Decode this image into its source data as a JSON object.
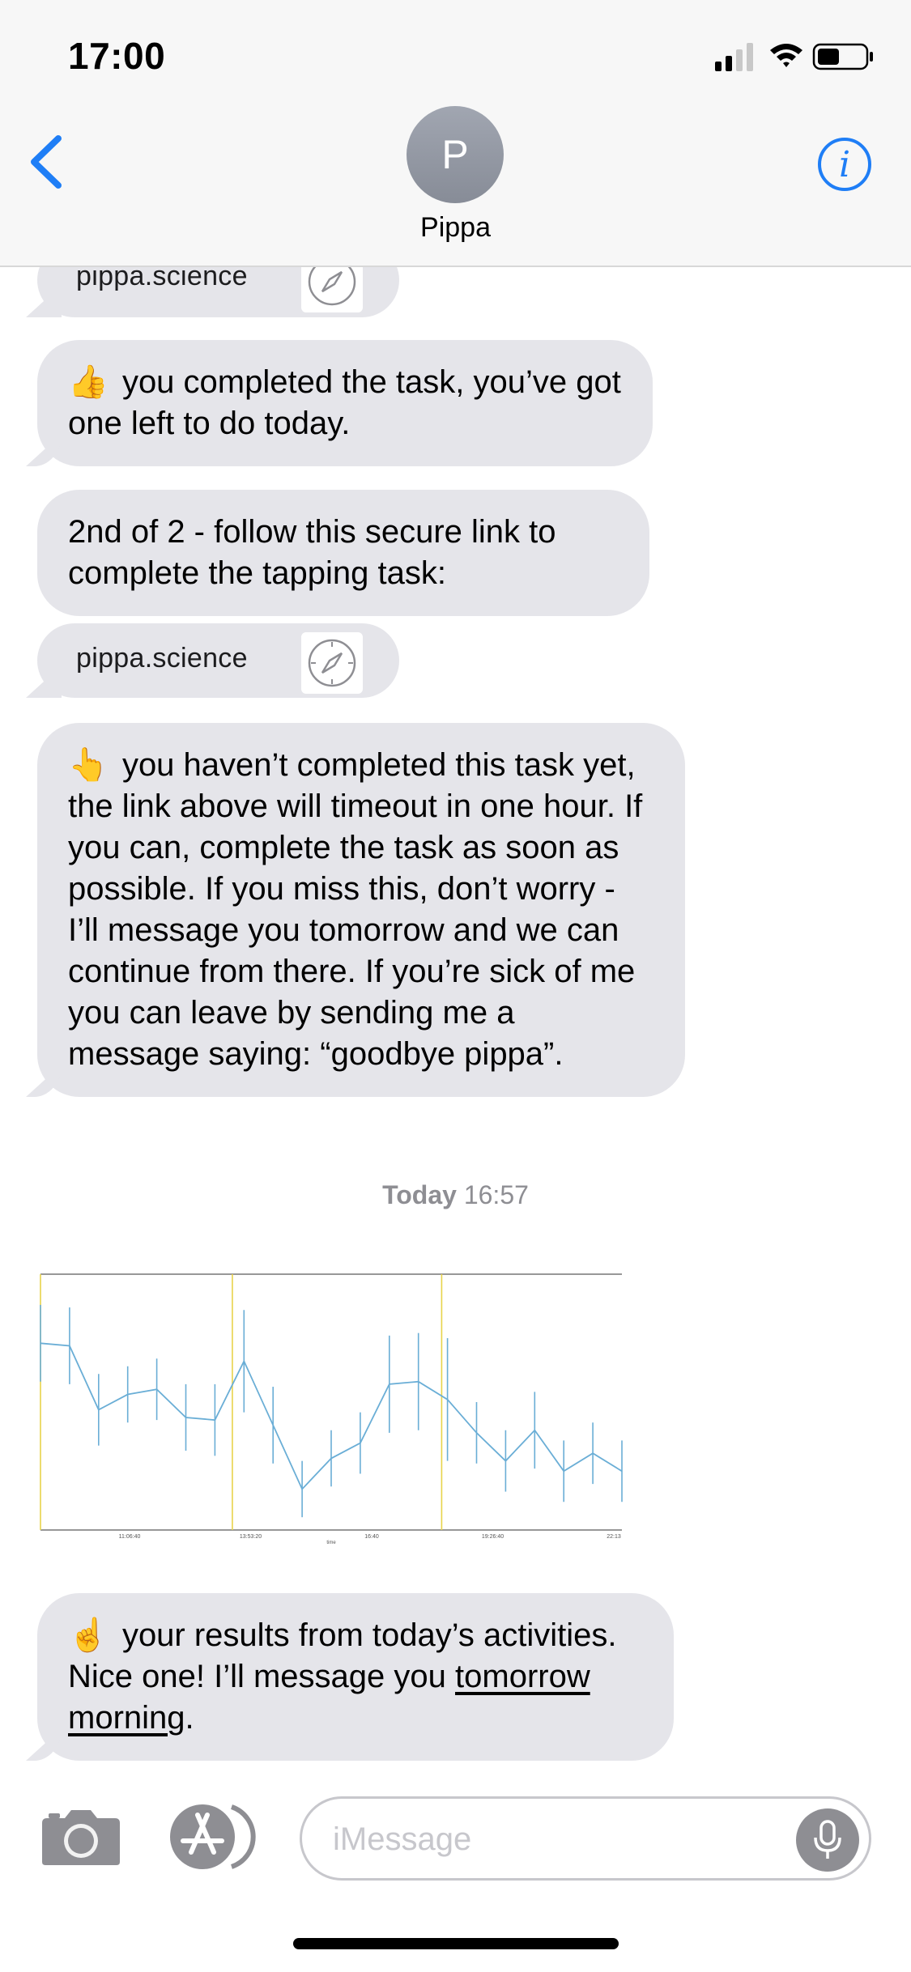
{
  "status_bar": {
    "time": "17:00"
  },
  "header": {
    "avatar_initial": "P",
    "contact_name": "Pippa",
    "info_glyph": "i"
  },
  "messages": {
    "link_top": {
      "text": "pippa.science"
    },
    "msg1": {
      "emoji": "👍",
      "text": "you completed the task, you’ve got one left to do today."
    },
    "msg2": {
      "text": "2nd of 2 - follow this secure link to complete the tapping task:"
    },
    "link2": {
      "text": "pippa.science"
    },
    "msg3": {
      "emoji": "👆",
      "text": "you haven’t completed this task yet, the link above will timeout in one hour. If you can, complete the task as soon as possible. If you miss this, don’t worry - I’ll message you tomorrow and we can continue from there. If you’re sick of me you can leave by sending me a message saying: “goodbye pippa”."
    },
    "timestamp": {
      "day": "Today",
      "time": "16:57"
    },
    "msg4": {
      "emoji": "☝️",
      "text_before": "your results from today’s activities. Nice one! I’ll message you ",
      "link_text": "tomorrow morning",
      "text_after": "."
    }
  },
  "input_bar": {
    "placeholder": "iMessage"
  },
  "chart_data": {
    "type": "line",
    "title": "",
    "xlabel": "time",
    "ylabel": "",
    "x_tick_labels": [
      "11:06:40",
      "13:53:20",
      "16:40",
      "19:26:40",
      "22:13"
    ],
    "series": [
      {
        "values": [
          0.73,
          0.72,
          0.47,
          0.53,
          0.55,
          0.44,
          0.43,
          0.66,
          0.41,
          0.16,
          0.28,
          0.34,
          0.57,
          0.58,
          0.51,
          0.38,
          0.27,
          0.39,
          0.23,
          0.3,
          0.23
        ],
        "error": [
          0.15,
          0.15,
          0.14,
          0.11,
          0.12,
          0.13,
          0.14,
          0.2,
          0.15,
          0.11,
          0.11,
          0.12,
          0.19,
          0.19,
          0.24,
          0.12,
          0.12,
          0.15,
          0.12,
          0.12,
          0.12
        ]
      }
    ],
    "vertical_markers": [
      0,
      0.33,
      0.69
    ],
    "line_color": "#6aaed6",
    "marker_color": "#e8d34a",
    "ylim": [
      0,
      1
    ]
  }
}
